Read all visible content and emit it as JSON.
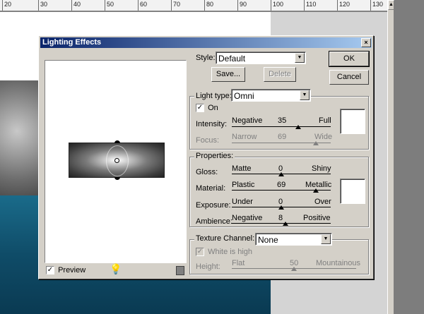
{
  "ruler": {
    "marks": [
      "20",
      "30",
      "40",
      "50",
      "60",
      "70",
      "80",
      "90",
      "100",
      "110",
      "120",
      "130"
    ]
  },
  "dialog": {
    "title": "Lighting Effects",
    "close_glyph": "×",
    "style_label": "Style:",
    "style_value": "Default",
    "save_label": "Save...",
    "delete_label": "Delete",
    "ok_label": "OK",
    "cancel_label": "Cancel",
    "light_type_label": "Light type:",
    "light_type_value": "Omni",
    "on_label": "On",
    "on_checked": true,
    "intensity": {
      "label": "Intensity:",
      "left": "Negative",
      "value": "35",
      "right": "Full",
      "fraction": 0.67
    },
    "focus": {
      "label": "Focus:",
      "left": "Narrow",
      "value": "69",
      "right": "Wide",
      "fraction": 0.85
    },
    "properties_label": "Properties:",
    "gloss": {
      "label": "Gloss:",
      "left": "Matte",
      "value": "0",
      "right": "Shiny",
      "fraction": 0.5
    },
    "material": {
      "label": "Material:",
      "left": "Plastic",
      "value": "69",
      "right": "Metallic",
      "fraction": 0.85
    },
    "exposure": {
      "label": "Exposure:",
      "left": "Under",
      "value": "0",
      "right": "Over",
      "fraction": 0.5
    },
    "ambience": {
      "label": "Ambience:",
      "left": "Negative",
      "value": "8",
      "right": "Positive",
      "fraction": 0.54
    },
    "texture_label": "Texture Channel:",
    "texture_value": "None",
    "white_is_high_label": "White is high",
    "height": {
      "label": "Height:",
      "left": "Flat",
      "value": "50",
      "right": "Mountainous",
      "fraction": 0.5
    },
    "preview_label": "Preview",
    "preview_checked": true,
    "check_glyph": "✓",
    "dropdown_glyph": "▼",
    "colors": {
      "title_start": "#0a246a",
      "title_end": "#a6caf0",
      "face": "#d4d0c8"
    }
  },
  "icons": {
    "bulb": "light-bulb-icon",
    "trash": "trash-icon"
  }
}
